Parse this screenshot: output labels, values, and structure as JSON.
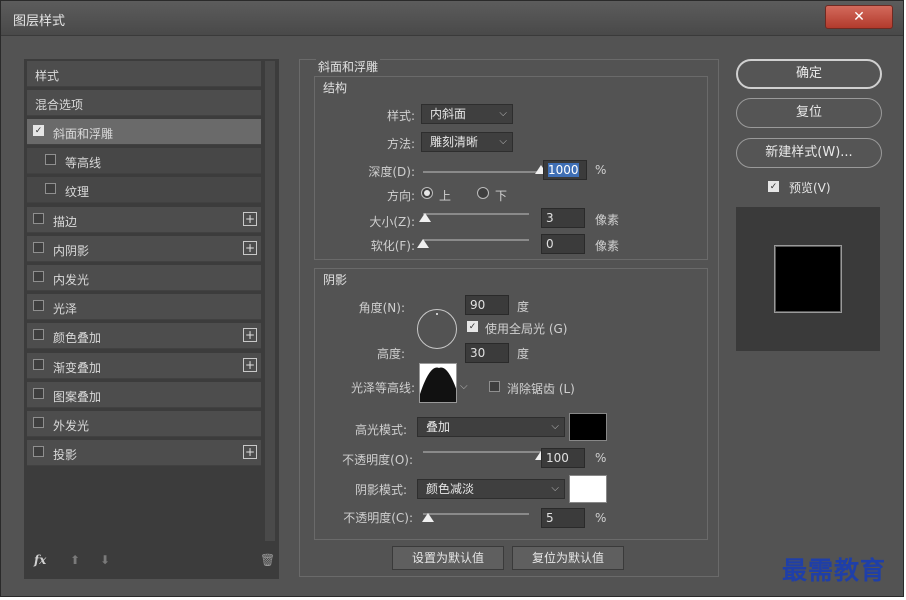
{
  "window": {
    "title": "图层样式",
    "close_label": "✕"
  },
  "left_panel": {
    "header": "样式",
    "blend": "混合选项",
    "items": [
      {
        "label": "斜面和浮雕",
        "checked": true,
        "selected": true
      },
      {
        "label": "等高线",
        "checked": false,
        "sub": true
      },
      {
        "label": "纹理",
        "checked": false,
        "sub": true
      },
      {
        "label": "描边",
        "checked": false,
        "plus": true
      },
      {
        "label": "内阴影",
        "checked": false,
        "plus": true
      },
      {
        "label": "内发光",
        "checked": false
      },
      {
        "label": "光泽",
        "checked": false
      },
      {
        "label": "颜色叠加",
        "checked": false,
        "plus": true
      },
      {
        "label": "渐变叠加",
        "checked": false,
        "plus": true
      },
      {
        "label": "图案叠加",
        "checked": false
      },
      {
        "label": "外发光",
        "checked": false
      },
      {
        "label": "投影",
        "checked": false,
        "plus": true
      }
    ],
    "footer": {
      "fx": "fx",
      "up": "⬆",
      "down": "⬇",
      "trash": "🗑"
    }
  },
  "bevel": {
    "section_title": "斜面和浮雕",
    "structure_title": "结构",
    "style_label": "样式:",
    "style_value": "内斜面",
    "method_label": "方法:",
    "method_value": "雕刻清晰",
    "depth_label": "深度(D):",
    "depth_value": "1000",
    "depth_unit": "%",
    "depth_slider": 1.0,
    "direction_label": "方向:",
    "dir_up": "上",
    "dir_down": "下",
    "size_label": "大小(Z):",
    "size_value": "3",
    "size_unit": "像素",
    "size_slider": 0.02,
    "soften_label": "软化(F):",
    "soften_value": "0",
    "soften_unit": "像素",
    "soften_slider": 0.0
  },
  "shading": {
    "title": "阴影",
    "angle_label": "角度(N):",
    "angle_value": "90",
    "angle_unit": "度",
    "global_light_label": "使用全局光 (G)",
    "altitude_label": "高度:",
    "altitude_value": "30",
    "altitude_unit": "度",
    "gloss_label": "光泽等高线:",
    "antialias_label": "消除锯齿 (L)",
    "highlight_label": "高光模式:",
    "highlight_value": "叠加",
    "highlight_color": "#000000",
    "hl_opacity_label": "不透明度(O):",
    "hl_opacity_value": "100",
    "hl_opacity_unit": "%",
    "hl_opacity_slider": 1.0,
    "shadow_label": "阴影模式:",
    "shadow_value": "颜色减淡",
    "shadow_color": "#ffffff",
    "sh_opacity_label": "不透明度(C):",
    "sh_opacity_value": "5",
    "sh_opacity_unit": "%",
    "sh_opacity_slider": 0.05
  },
  "bottom_buttons": {
    "make_default": "设置为默认值",
    "reset_default": "复位为默认值"
  },
  "right_panel": {
    "ok": "确定",
    "reset": "复位",
    "new_style": "新建样式(W)...",
    "preview_label": "预览(V)"
  },
  "watermark": "最需教育"
}
